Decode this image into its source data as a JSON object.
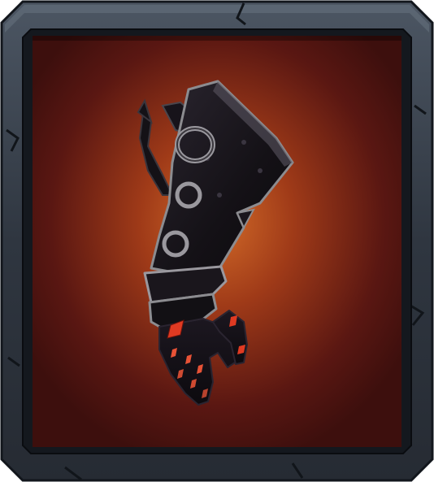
{
  "item_card": {
    "icon": "armored-gauntlet-icon",
    "frame_style": "stone-frame",
    "colors": {
      "frame_outer": "#3b4450",
      "frame_inner": "#161b22",
      "background_glow": "#c35a1c",
      "background_dark": "#4a1210",
      "gauntlet_body": "#19151a",
      "metal_trim": "#8c8c90",
      "gem_red": "#e03a22"
    }
  }
}
